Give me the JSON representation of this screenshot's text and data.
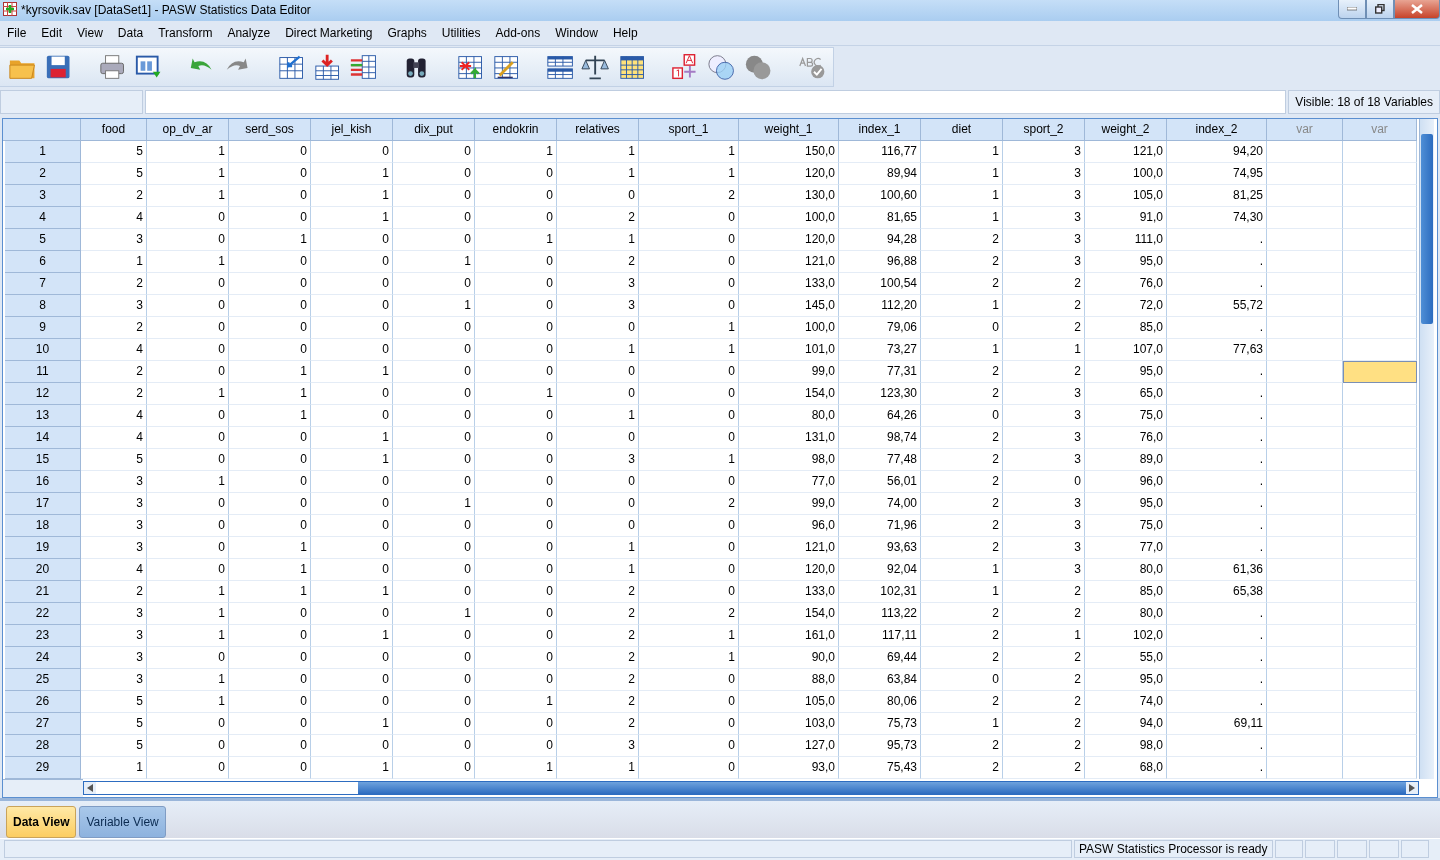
{
  "window": {
    "title": "*kyrsovik.sav [DataSet1] - PASW Statistics Data Editor"
  },
  "menu": [
    "File",
    "Edit",
    "View",
    "Data",
    "Transform",
    "Analyze",
    "Direct Marketing",
    "Graphs",
    "Utilities",
    "Add-ons",
    "Window",
    "Help"
  ],
  "cell_editor": {
    "visible_label": "Visible: 18 of 18 Variables"
  },
  "table": {
    "columns": [
      {
        "name": "food",
        "kind": "variable"
      },
      {
        "name": "op_dv_ar",
        "kind": "variable"
      },
      {
        "name": "serd_sos",
        "kind": "variable"
      },
      {
        "name": "jel_kish",
        "kind": "variable"
      },
      {
        "name": "dix_put",
        "kind": "variable"
      },
      {
        "name": "endokrin",
        "kind": "variable"
      },
      {
        "name": "relatives",
        "kind": "variable"
      },
      {
        "name": "sport_1",
        "kind": "variable"
      },
      {
        "name": "weight_1",
        "kind": "variable"
      },
      {
        "name": "index_1",
        "kind": "variable"
      },
      {
        "name": "diet",
        "kind": "variable"
      },
      {
        "name": "sport_2",
        "kind": "variable"
      },
      {
        "name": "weight_2",
        "kind": "variable"
      },
      {
        "name": "index_2",
        "kind": "variable"
      },
      {
        "name": "var",
        "kind": "empty"
      },
      {
        "name": "var",
        "kind": "empty"
      }
    ],
    "rows": [
      {
        "label": "1",
        "values": [
          "5",
          "1",
          "0",
          "0",
          "0",
          "1",
          "1",
          "1",
          "150,0",
          "116,77",
          "1",
          "3",
          "121,0",
          "94,20"
        ],
        "blank_cells": [
          {
            "selected": false
          },
          {
            "selected": false
          }
        ]
      },
      {
        "label": "2",
        "values": [
          "5",
          "1",
          "0",
          "1",
          "0",
          "0",
          "1",
          "1",
          "120,0",
          "89,94",
          "1",
          "3",
          "100,0",
          "74,95"
        ],
        "blank_cells": [
          {
            "selected": false
          },
          {
            "selected": false
          }
        ]
      },
      {
        "label": "3",
        "values": [
          "2",
          "1",
          "0",
          "1",
          "0",
          "0",
          "0",
          "2",
          "130,0",
          "100,60",
          "1",
          "3",
          "105,0",
          "81,25"
        ],
        "blank_cells": [
          {
            "selected": false
          },
          {
            "selected": false
          }
        ]
      },
      {
        "label": "4",
        "values": [
          "4",
          "0",
          "0",
          "1",
          "0",
          "0",
          "2",
          "0",
          "100,0",
          "81,65",
          "1",
          "3",
          "91,0",
          "74,30"
        ],
        "blank_cells": [
          {
            "selected": false
          },
          {
            "selected": false
          }
        ]
      },
      {
        "label": "5",
        "values": [
          "3",
          "0",
          "1",
          "0",
          "0",
          "1",
          "1",
          "0",
          "120,0",
          "94,28",
          "2",
          "3",
          "111,0",
          "."
        ],
        "blank_cells": [
          {
            "selected": false
          },
          {
            "selected": false
          }
        ]
      },
      {
        "label": "6",
        "values": [
          "1",
          "1",
          "0",
          "0",
          "1",
          "0",
          "2",
          "0",
          "121,0",
          "96,88",
          "2",
          "3",
          "95,0",
          "."
        ],
        "blank_cells": [
          {
            "selected": false
          },
          {
            "selected": false
          }
        ]
      },
      {
        "label": "7",
        "values": [
          "2",
          "0",
          "0",
          "0",
          "0",
          "0",
          "3",
          "0",
          "133,0",
          "100,54",
          "2",
          "2",
          "76,0",
          "."
        ],
        "blank_cells": [
          {
            "selected": false
          },
          {
            "selected": false
          }
        ]
      },
      {
        "label": "8",
        "values": [
          "3",
          "0",
          "0",
          "0",
          "1",
          "0",
          "3",
          "0",
          "145,0",
          "112,20",
          "1",
          "2",
          "72,0",
          "55,72"
        ],
        "blank_cells": [
          {
            "selected": false
          },
          {
            "selected": false
          }
        ]
      },
      {
        "label": "9",
        "values": [
          "2",
          "0",
          "0",
          "0",
          "0",
          "0",
          "0",
          "1",
          "100,0",
          "79,06",
          "0",
          "2",
          "85,0",
          "."
        ],
        "blank_cells": [
          {
            "selected": false
          },
          {
            "selected": false
          }
        ]
      },
      {
        "label": "10",
        "values": [
          "4",
          "0",
          "0",
          "0",
          "0",
          "0",
          "1",
          "1",
          "101,0",
          "73,27",
          "1",
          "1",
          "107,0",
          "77,63"
        ],
        "blank_cells": [
          {
            "selected": false
          },
          {
            "selected": false
          }
        ]
      },
      {
        "label": "11",
        "values": [
          "2",
          "0",
          "1",
          "1",
          "0",
          "0",
          "0",
          "0",
          "99,0",
          "77,31",
          "2",
          "2",
          "95,0",
          "."
        ],
        "blank_cells": [
          {
            "selected": false
          },
          {
            "selected": true
          }
        ]
      },
      {
        "label": "12",
        "values": [
          "2",
          "1",
          "1",
          "0",
          "0",
          "1",
          "0",
          "0",
          "154,0",
          "123,30",
          "2",
          "3",
          "65,0",
          "."
        ],
        "blank_cells": [
          {
            "selected": false
          },
          {
            "selected": false
          }
        ]
      },
      {
        "label": "13",
        "values": [
          "4",
          "0",
          "1",
          "0",
          "0",
          "0",
          "1",
          "0",
          "80,0",
          "64,26",
          "0",
          "3",
          "75,0",
          "."
        ],
        "blank_cells": [
          {
            "selected": false
          },
          {
            "selected": false
          }
        ]
      },
      {
        "label": "14",
        "values": [
          "4",
          "0",
          "0",
          "1",
          "0",
          "0",
          "0",
          "0",
          "131,0",
          "98,74",
          "2",
          "3",
          "76,0",
          "."
        ],
        "blank_cells": [
          {
            "selected": false
          },
          {
            "selected": false
          }
        ]
      },
      {
        "label": "15",
        "values": [
          "5",
          "0",
          "0",
          "1",
          "0",
          "0",
          "3",
          "1",
          "98,0",
          "77,48",
          "2",
          "3",
          "89,0",
          "."
        ],
        "blank_cells": [
          {
            "selected": false
          },
          {
            "selected": false
          }
        ]
      },
      {
        "label": "16",
        "values": [
          "3",
          "1",
          "0",
          "0",
          "0",
          "0",
          "0",
          "0",
          "77,0",
          "56,01",
          "2",
          "0",
          "96,0",
          "."
        ],
        "blank_cells": [
          {
            "selected": false
          },
          {
            "selected": false
          }
        ]
      },
      {
        "label": "17",
        "values": [
          "3",
          "0",
          "0",
          "0",
          "1",
          "0",
          "0",
          "2",
          "99,0",
          "74,00",
          "2",
          "3",
          "95,0",
          "."
        ],
        "blank_cells": [
          {
            "selected": false
          },
          {
            "selected": false
          }
        ]
      },
      {
        "label": "18",
        "values": [
          "3",
          "0",
          "0",
          "0",
          "0",
          "0",
          "0",
          "0",
          "96,0",
          "71,96",
          "2",
          "3",
          "75,0",
          "."
        ],
        "blank_cells": [
          {
            "selected": false
          },
          {
            "selected": false
          }
        ]
      },
      {
        "label": "19",
        "values": [
          "3",
          "0",
          "1",
          "0",
          "0",
          "0",
          "1",
          "0",
          "121,0",
          "93,63",
          "2",
          "3",
          "77,0",
          "."
        ],
        "blank_cells": [
          {
            "selected": false
          },
          {
            "selected": false
          }
        ]
      },
      {
        "label": "20",
        "values": [
          "4",
          "0",
          "1",
          "0",
          "0",
          "0",
          "1",
          "0",
          "120,0",
          "92,04",
          "1",
          "3",
          "80,0",
          "61,36"
        ],
        "blank_cells": [
          {
            "selected": false
          },
          {
            "selected": false
          }
        ]
      },
      {
        "label": "21",
        "values": [
          "2",
          "1",
          "1",
          "1",
          "0",
          "0",
          "2",
          "0",
          "133,0",
          "102,31",
          "1",
          "2",
          "85,0",
          "65,38"
        ],
        "blank_cells": [
          {
            "selected": false
          },
          {
            "selected": false
          }
        ]
      },
      {
        "label": "22",
        "values": [
          "3",
          "1",
          "0",
          "0",
          "1",
          "0",
          "2",
          "2",
          "154,0",
          "113,22",
          "2",
          "2",
          "80,0",
          "."
        ],
        "blank_cells": [
          {
            "selected": false
          },
          {
            "selected": false
          }
        ]
      },
      {
        "label": "23",
        "values": [
          "3",
          "1",
          "0",
          "1",
          "0",
          "0",
          "2",
          "1",
          "161,0",
          "117,11",
          "2",
          "1",
          "102,0",
          "."
        ],
        "blank_cells": [
          {
            "selected": false
          },
          {
            "selected": false
          }
        ]
      },
      {
        "label": "24",
        "values": [
          "3",
          "0",
          "0",
          "0",
          "0",
          "0",
          "2",
          "1",
          "90,0",
          "69,44",
          "2",
          "2",
          "55,0",
          "."
        ],
        "blank_cells": [
          {
            "selected": false
          },
          {
            "selected": false
          }
        ]
      },
      {
        "label": "25",
        "values": [
          "3",
          "1",
          "0",
          "0",
          "0",
          "0",
          "2",
          "0",
          "88,0",
          "63,84",
          "0",
          "2",
          "95,0",
          "."
        ],
        "blank_cells": [
          {
            "selected": false
          },
          {
            "selected": false
          }
        ]
      },
      {
        "label": "26",
        "values": [
          "5",
          "1",
          "0",
          "0",
          "0",
          "1",
          "2",
          "0",
          "105,0",
          "80,06",
          "2",
          "2",
          "74,0",
          "."
        ],
        "blank_cells": [
          {
            "selected": false
          },
          {
            "selected": false
          }
        ]
      },
      {
        "label": "27",
        "values": [
          "5",
          "0",
          "0",
          "1",
          "0",
          "0",
          "2",
          "0",
          "103,0",
          "75,73",
          "1",
          "2",
          "94,0",
          "69,11"
        ],
        "blank_cells": [
          {
            "selected": false
          },
          {
            "selected": false
          }
        ]
      },
      {
        "label": "28",
        "values": [
          "5",
          "0",
          "0",
          "0",
          "0",
          "0",
          "3",
          "0",
          "127,0",
          "95,73",
          "2",
          "2",
          "98,0",
          "."
        ],
        "blank_cells": [
          {
            "selected": false
          },
          {
            "selected": false
          }
        ]
      },
      {
        "label": "29",
        "values": [
          "1",
          "0",
          "0",
          "1",
          "0",
          "1",
          "1",
          "0",
          "93,0",
          "75,43",
          "2",
          "2",
          "68,0",
          "."
        ],
        "blank_cells": [
          {
            "selected": false
          },
          {
            "selected": false
          }
        ]
      }
    ]
  },
  "tabs": [
    {
      "label": "Data View",
      "selected": true
    },
    {
      "label": "Variable View",
      "selected": false
    }
  ],
  "status_bar": {
    "message": "PASW Statistics Processor is ready"
  }
}
